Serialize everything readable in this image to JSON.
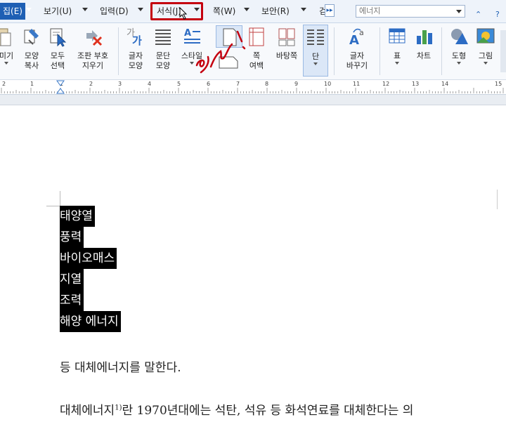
{
  "menu": {
    "items": [
      {
        "label": "집(E)"
      },
      {
        "label": "보기(U)"
      },
      {
        "label": "입력(D)"
      },
      {
        "label": "서식(J)"
      },
      {
        "label": "쪽(W)"
      },
      {
        "label": "보안(R)"
      },
      {
        "label": "검"
      }
    ],
    "search_value": "에너지"
  },
  "ribbon": {
    "buttons": [
      {
        "label": "미기",
        "icon": "clipboard-icon"
      },
      {
        "label": "모양\n복사",
        "icon": "format-painter-icon"
      },
      {
        "label": "모두\n선택",
        "icon": "select-all-icon"
      },
      {
        "label": "조판 부호\n지우기",
        "icon": "erase-markup-icon"
      },
      {
        "label": "글자\n모양",
        "icon": "char-shape-icon"
      },
      {
        "label": "문단\n모양",
        "icon": "paragraph-shape-icon"
      },
      {
        "label": "스타일",
        "icon": "style-icon"
      },
      {
        "label": "쪽\n여백",
        "icon": "page-margin-icon"
      },
      {
        "label": "바탕쪽",
        "icon": "master-page-icon"
      },
      {
        "label": "단",
        "icon": "columns-icon"
      },
      {
        "label": "글자\n바꾸기",
        "icon": "change-char-icon"
      },
      {
        "label": "표",
        "icon": "table-icon"
      },
      {
        "label": "차트",
        "icon": "chart-icon"
      },
      {
        "label": "도형",
        "icon": "shape-icon"
      },
      {
        "label": "그림",
        "icon": "picture-icon"
      }
    ]
  },
  "ruler": {
    "numbers": [
      "2",
      "1",
      "1",
      "2",
      "3",
      "4",
      "5",
      "6",
      "7",
      "8",
      "9",
      "10",
      "11",
      "12",
      "13",
      "14",
      "15"
    ]
  },
  "document": {
    "selected_lines": [
      "태양열",
      "풍력",
      "바이오매스",
      "지열",
      "조력",
      "해양 에너지"
    ],
    "paragraph1": "등 대체에너지를 말한다.",
    "paragraph2_a": "대체에너지",
    "paragraph2_sup": "1)",
    "paragraph2_b": "란 1970년대에는 석탄, 석유 등 화석연료를 대체한다는 의"
  },
  "colors": {
    "menu_active": "#1e5fb4",
    "annotation_red": "#c4000f",
    "selection": "#000000"
  }
}
